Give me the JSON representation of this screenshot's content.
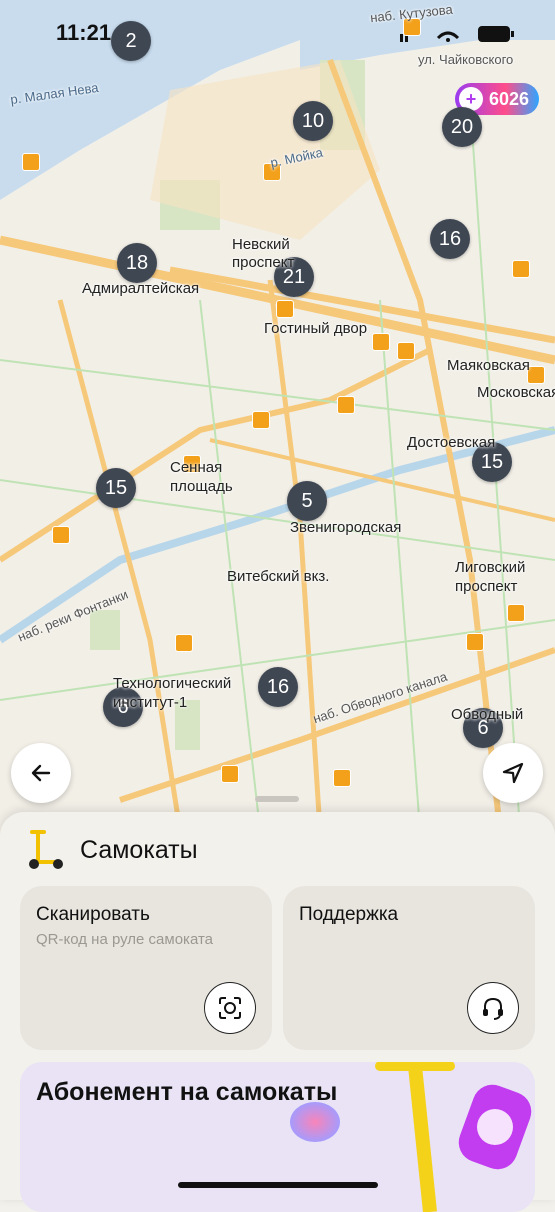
{
  "status_bar": {
    "time": "11:21"
  },
  "plus_badge": {
    "points": "6026"
  },
  "clusters": [
    "2",
    "10",
    "20",
    "18",
    "21",
    "16",
    "15",
    "5",
    "15",
    "6",
    "16",
    "6"
  ],
  "map_labels": {
    "nevsky": "Невский проспект",
    "admiralteyskaya": "Адмиралтейская",
    "gostiny": "Гостиный двор",
    "mayakovskaya": "Маяковская",
    "moskovskaya": "Московская",
    "dostoevskaya": "Достоевская",
    "sennaya": "Сенная площадь",
    "zvenigorodskaya": "Звенигородская",
    "vitebsky": "Витебский вкз.",
    "ligovsky": "Лиговский проспект",
    "tekhnolog": "Технологический институт-1",
    "obvodny": "Обводный",
    "street_fontanka": "наб. реки Фонтанки",
    "street_obvodny": "наб. Обводного канала",
    "street_kutuzova": "наб. Кутузова",
    "street_malaya_neva": "р. Малая Нева",
    "street_moika": "р. Мойка",
    "street_chaikovskogo": "ул. Чайковского"
  },
  "sheet": {
    "title": "Самокаты",
    "scan_title": "Сканировать",
    "scan_subtitle": "QR-код на руле самоката",
    "support_title": "Поддержка",
    "promo_title": "Абонемент на самокаты"
  },
  "colors": {
    "accent": "#f3a11b",
    "cluster": "#3f4753",
    "water": "#c8dcee",
    "park": "#d7e5c4"
  },
  "icons": [
    "back-arrow-icon",
    "navigation-arrow-icon",
    "scan-icon",
    "headset-icon",
    "scooter-icon",
    "metro-icon"
  ]
}
